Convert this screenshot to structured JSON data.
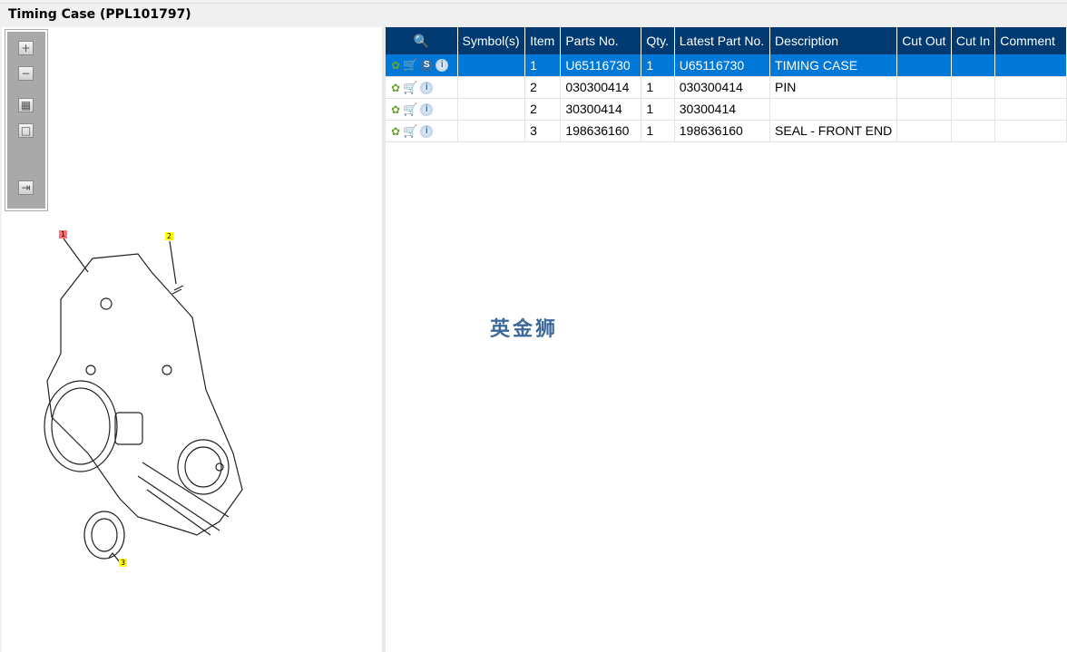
{
  "title": "Timing Case (PPL101797)",
  "toolbar": {
    "zoom_in": "+",
    "zoom_out": "−",
    "fit_all": "▦",
    "fit_window": "□",
    "export": "⇥"
  },
  "drawing": {
    "callouts": [
      "1",
      "2",
      "3"
    ]
  },
  "table": {
    "headers": [
      "",
      "Symbol(s)",
      "Item",
      "Parts No.",
      "Qty.",
      "Latest Part No.",
      "Description",
      "Cut Out",
      "Cut In",
      "Comment"
    ],
    "rows": [
      {
        "item": "1",
        "parts_no": "U65116730",
        "qty": "1",
        "latest": "U65116730",
        "description": "TIMING CASE",
        "has_s": true,
        "selected": true
      },
      {
        "item": "2",
        "parts_no": "030300414",
        "qty": "1",
        "latest": "030300414",
        "description": "PIN"
      },
      {
        "item": "2",
        "parts_no": "30300414",
        "qty": "1",
        "latest": "30300414",
        "description": ""
      },
      {
        "item": "3",
        "parts_no": "198636160",
        "qty": "1",
        "latest": "198636160",
        "description": "SEAL - FRONT END"
      }
    ]
  },
  "watermark": "英金狮",
  "colors": {
    "header": "#003a70",
    "selected": "#0078d7"
  }
}
